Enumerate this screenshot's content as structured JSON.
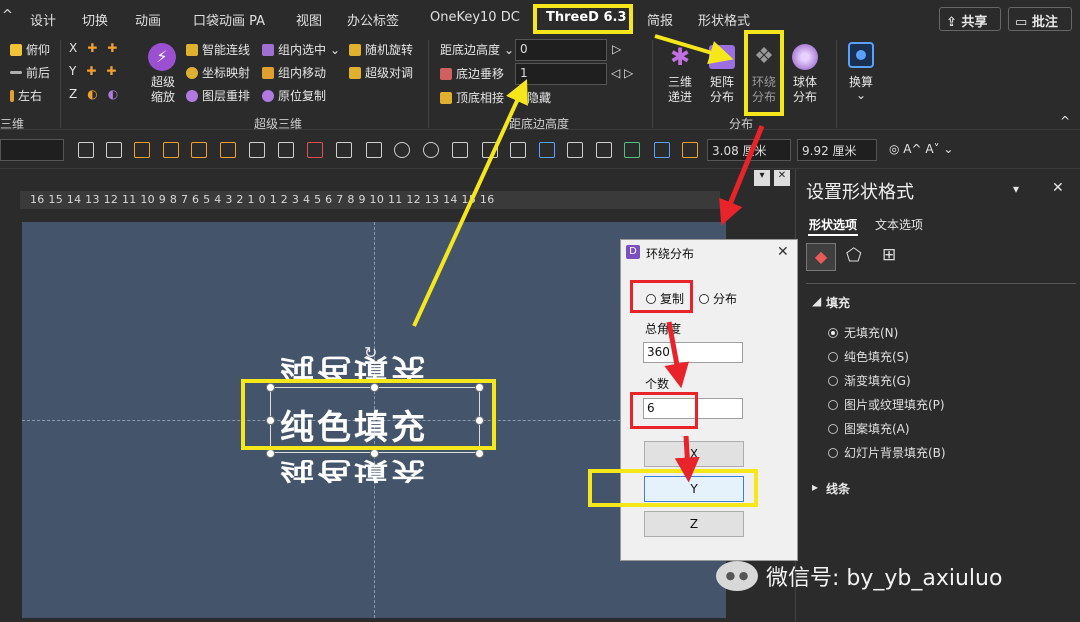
{
  "tabs": {
    "caret": "^",
    "design": "设计",
    "transition": "切换",
    "animation": "动画",
    "pocket": "口袋动画 PA",
    "view": "视图",
    "office_tag": "办公标签",
    "onekey": "OneKey10 DC",
    "threed": "ThreeD 6.3",
    "jianbao": "简报",
    "shape_format": "形状格式",
    "share": "共享",
    "comment": "批注"
  },
  "ribbon": {
    "col1": [
      "俯仰",
      "前后",
      "左右"
    ],
    "col1_group": "三维",
    "axes": [
      "X",
      "Y",
      "Z"
    ],
    "super_zoom": "超级缩放",
    "col3": [
      "智能连线",
      "坐标映射",
      "图层重排"
    ],
    "col4": [
      "组内选中",
      "组内移动",
      "原位复制"
    ],
    "col5": [
      "随机旋转",
      "超级对调"
    ],
    "group2": "超级三维",
    "dist_label": "距底边高度",
    "dist_value": "0",
    "bottom_move": "底边垂移",
    "bottom_move_value": "1",
    "top_bottom": "顶底相接",
    "hide": "隐藏",
    "group3": "距底边高度",
    "btn_3d": "三维递进",
    "btn_matrix": "矩阵分布",
    "btn_circle": "环绕分布",
    "btn_sphere": "球体分布",
    "group4": "分布",
    "btn_convert": "换算"
  },
  "format_bar": {
    "width_value": "3.08 厘米",
    "height_value": "9.92 厘米"
  },
  "ruler_text": "16 15 14 13 12 11 10 9 8 7 6 5 4 3 2 1 0 1 2 3 4 5 6 7 8 9 10 11 12 13 14 15 16",
  "slide": {
    "text_top": "纯色填充",
    "text_mid": "纯色填充",
    "text_bot": "纯色填充"
  },
  "pane": {
    "title": "设置形状格式",
    "tab_shape": "形状选项",
    "tab_text": "文本选项",
    "fill_header": "填充",
    "fill_options": [
      "无填充(N)",
      "纯色填充(S)",
      "渐变填充(G)",
      "图片或纹理填充(P)",
      "图案填充(A)",
      "幻灯片背景填充(B)"
    ],
    "line_header": "线条"
  },
  "dialog": {
    "title": "环绕分布",
    "radio_copy": "复制",
    "radio_dist": "分布",
    "total_angle_label": "总角度",
    "total_angle_value": "360",
    "count_label": "个数",
    "count_value": "6",
    "btn_x": "X",
    "btn_y": "Y",
    "btn_z": "Z"
  },
  "watermark": "微信号: by_yb_axiuluo",
  "colors": {
    "highlight": "#f5e71c",
    "marker": "#e8232a",
    "slide_bg": "#44546a"
  }
}
